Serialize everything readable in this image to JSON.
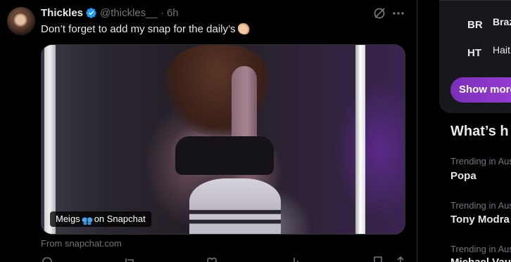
{
  "tweet": {
    "display_name": "Thickles",
    "handle": "@thickles__",
    "separator": "·",
    "timestamp": "6h",
    "text": "Don’t forget to add my snap for the daily’s",
    "card": {
      "overlay_label_prefix": "Meigs",
      "overlay_label_suffix": "on Snapchat"
    },
    "source": "From snapchat.com",
    "icons": {
      "verified": "verified-badge-icon",
      "grok": "grok-icon",
      "more": "more-icon",
      "emoji": "clapping-hands-emoji",
      "butterfly": "butterfly-emoji"
    }
  },
  "sidebar": {
    "languages": [
      {
        "code": "BR",
        "name": "Braz"
      },
      {
        "code": "HT",
        "name": "Hait"
      }
    ],
    "show_more_label": "Show more",
    "section_title": "What’s h",
    "trends": [
      {
        "context": "Trending in Aus",
        "name": "Popa"
      },
      {
        "context": "Trending in Aus",
        "name": "Tony Modra"
      },
      {
        "context": "Trending in Aus",
        "name": "Michael Vau"
      }
    ]
  },
  "colors": {
    "background": "#000000",
    "text_primary": "#e7e9ea",
    "text_secondary": "#71767b",
    "verified_blue": "#1d9bf0",
    "accent_purple": "#8a37c8",
    "border": "#2f3336"
  }
}
